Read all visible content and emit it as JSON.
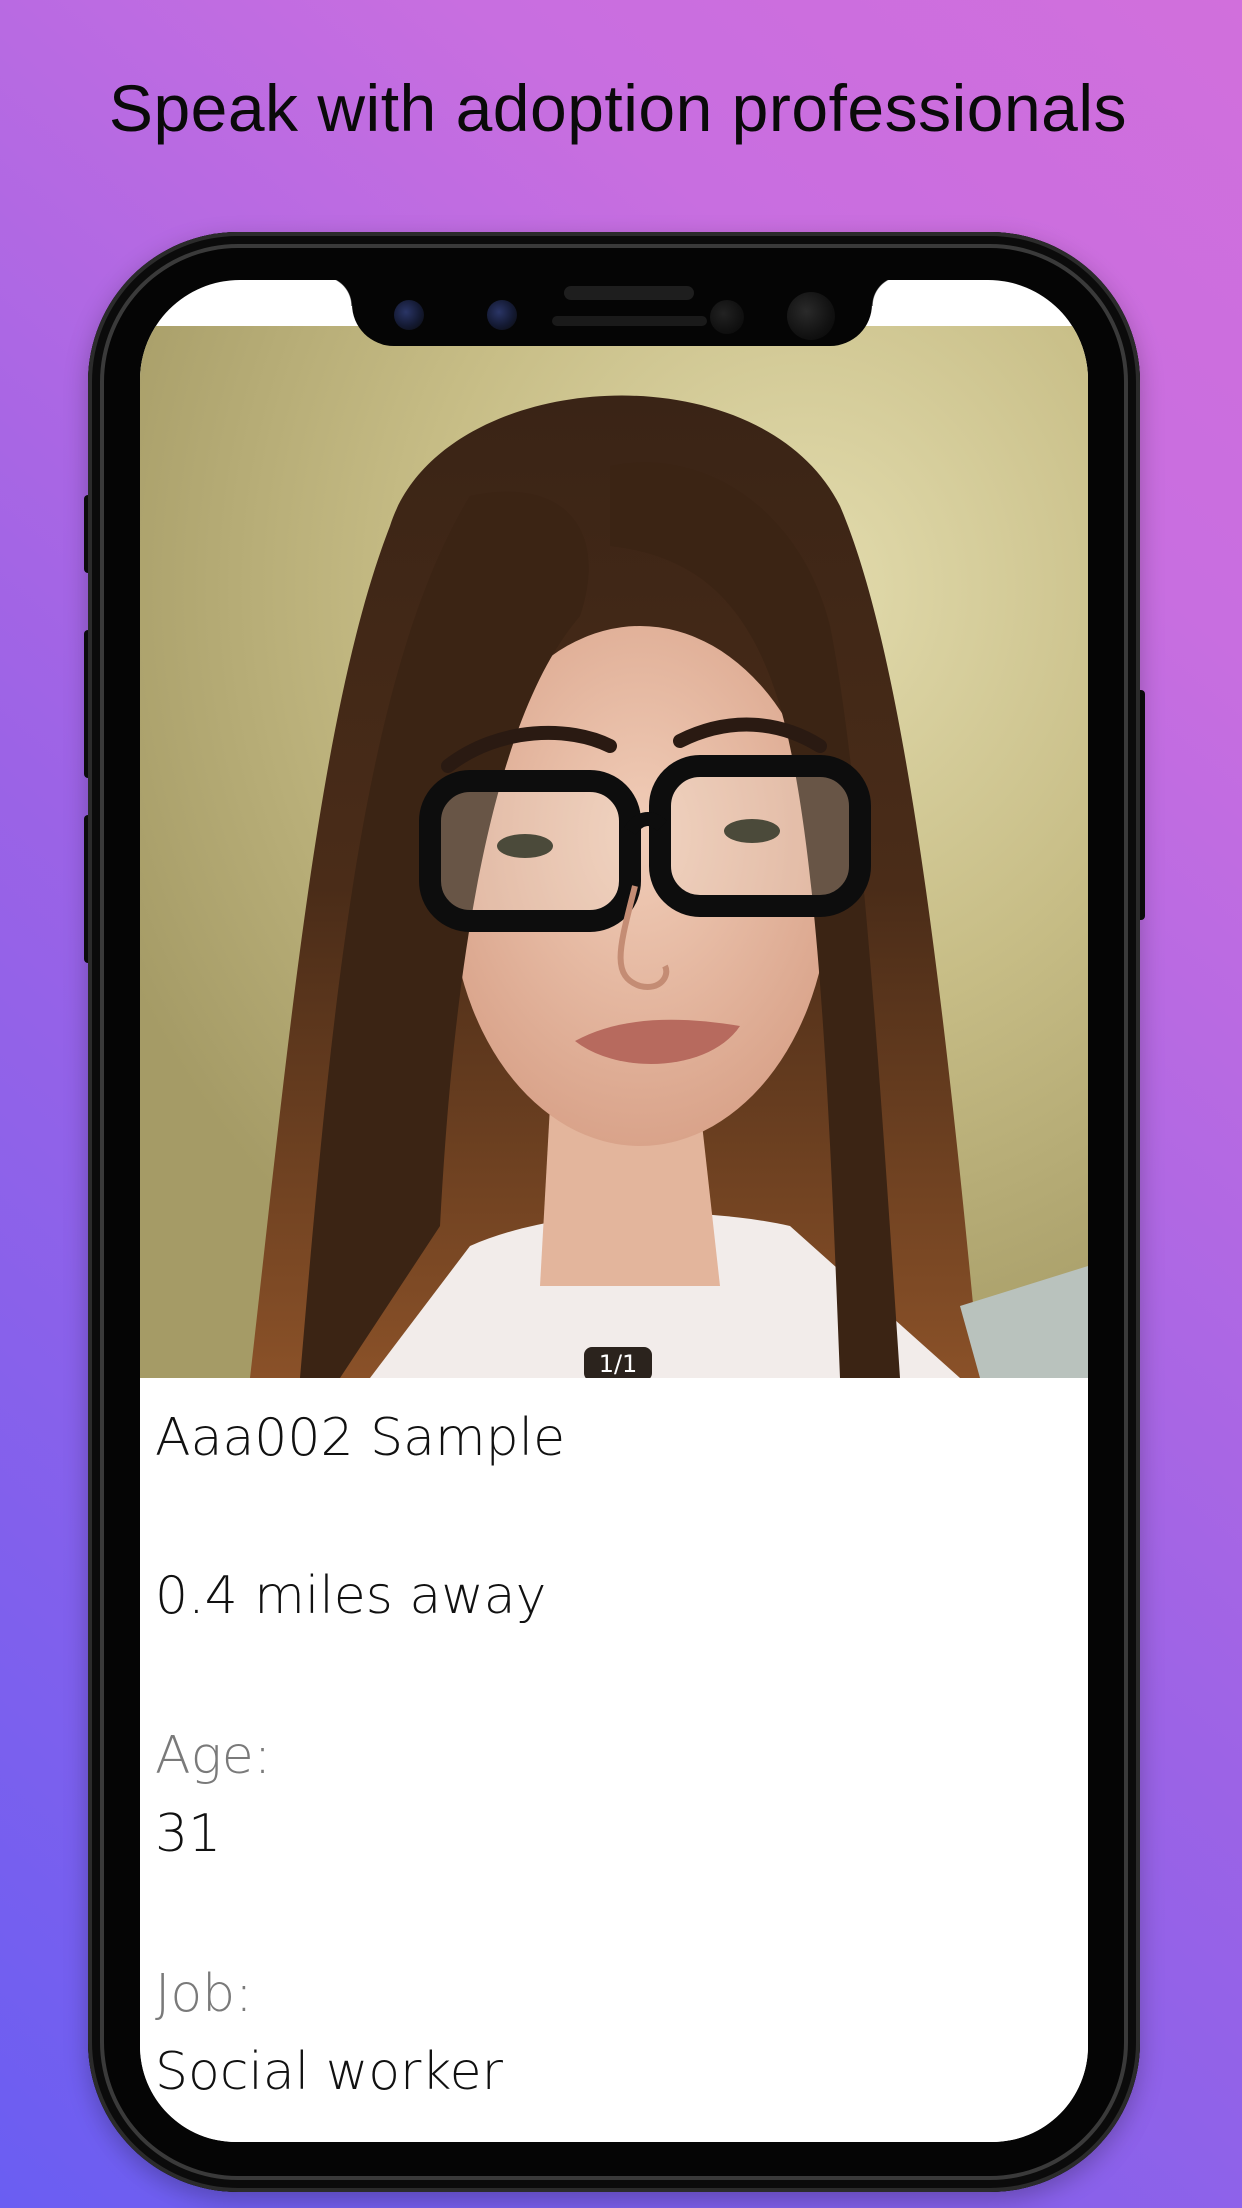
{
  "headline": "Speak with adoption professionals",
  "photo": {
    "description_icon": "profile-photo",
    "counter": "1/1"
  },
  "profile": {
    "name": "Aaa002 Sample",
    "distance": "0.4 miles away",
    "age_label": "Age:",
    "age_value": "31",
    "job_label": "Job:",
    "job_value": "Social worker"
  },
  "colors": {
    "background_start": "#6a5ef2",
    "background_end": "#d16fdc",
    "phone_frame": "#050505",
    "label_gray": "#7a7a7a"
  }
}
